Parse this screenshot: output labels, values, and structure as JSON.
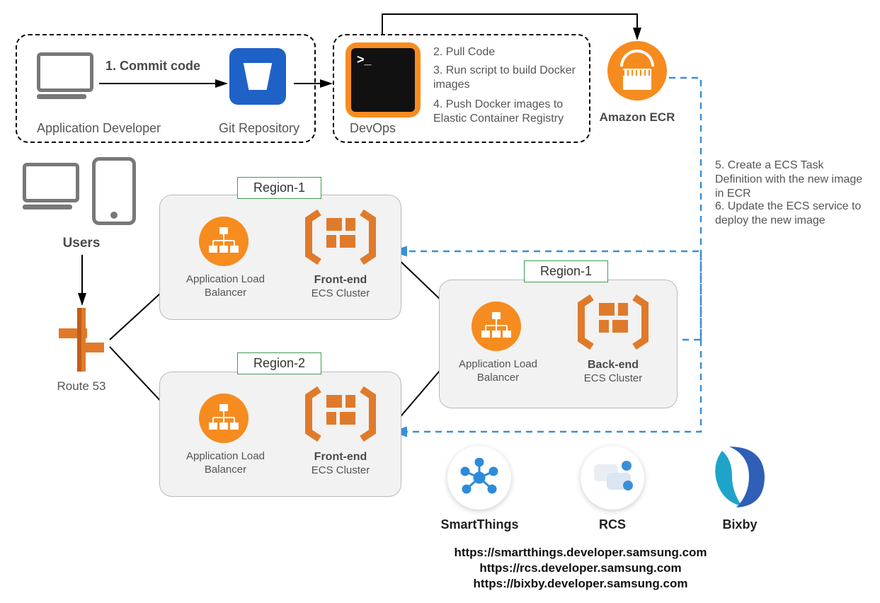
{
  "dev_box": {
    "label": "Application Developer"
  },
  "git": {
    "label": "Git Repository"
  },
  "commit": {
    "label": "1. Commit code"
  },
  "devops_box": {
    "label": "DevOps"
  },
  "devops_steps": {
    "s2": "2. Pull Code",
    "s3": "3. Run script to build Docker images",
    "s4": "4. Push Docker images to Elastic Container Registry"
  },
  "ecr": {
    "label": "Amazon ECR"
  },
  "side_steps": {
    "s5": "5. Create a ECS Task Definition with the new image in ECR",
    "s6": "6. Update the ECS service to deploy the new image"
  },
  "users": {
    "label": "Users"
  },
  "route53": {
    "label": "Route 53"
  },
  "tags": {
    "r1a": "Region-1",
    "r2": "Region-2",
    "r1b": "Region-1"
  },
  "alb": {
    "label": "Application Load Balancer"
  },
  "ecs_frontend": {
    "title": "Front-end",
    "sub": "ECS Cluster"
  },
  "ecs_backend": {
    "title": "Back-end",
    "sub": "ECS Cluster"
  },
  "brands": {
    "smartthings": "SmartThings",
    "rcs": "RCS",
    "bixby": "Bixby"
  },
  "urls": {
    "u1": "https://smartthings.developer.samsung.com",
    "u2": "https://rcs.developer.samsung.com",
    "u3": "https://bixby.developer.samsung.com"
  },
  "terminal_prompt": ">_"
}
